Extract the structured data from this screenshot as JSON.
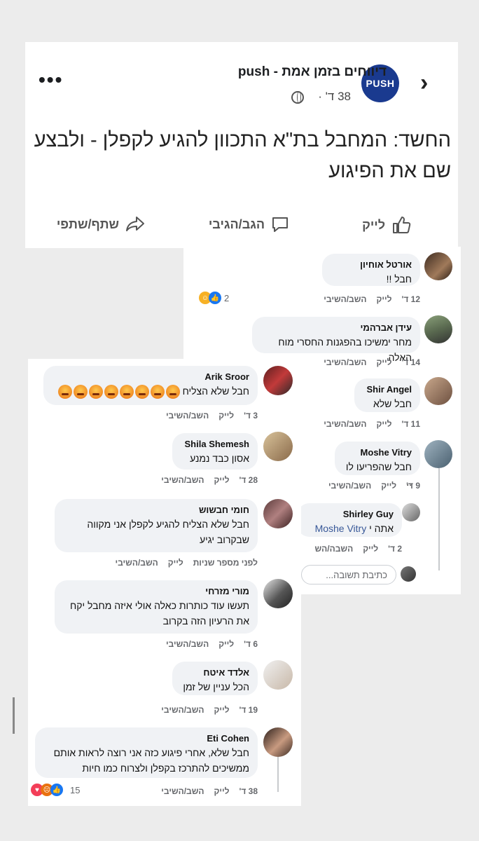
{
  "post": {
    "page_name": "דיווחים בזמן אמת - push",
    "logo_text": "PUSH",
    "time": "38 ד' ·",
    "headline": "החשד: המחבל בת\"א התכוון להגיע לקפלן - ולבצע שם את הפיגוע",
    "actions": {
      "like": "לייק",
      "comment": "הגב/הגיבי",
      "share": "שתף/שתפי"
    }
  },
  "labels": {
    "like": "לייק",
    "reply": "השב/השיבי",
    "reply_placeholder": "כתיבת תשובה..."
  },
  "comments_right": [
    {
      "name": "אורטל אוחיון",
      "text": "חבל !!",
      "time": "12 ד'",
      "reactions": "2"
    },
    {
      "name": "עידן אברהמי",
      "text": "מחר ימשיכו בהפגנות החסרי מוח האלה",
      "time": "14 ד'"
    },
    {
      "name": "Shir Angel",
      "text": "חבל שלא",
      "time": "11 ד'"
    },
    {
      "name": "Moshe Vitry",
      "text": "חבל שהפריעו לו ..",
      "time": "9 ד'"
    },
    {
      "name": "Shirley Guy",
      "mention": "Moshe Vitry",
      "text": "אתה י",
      "time": "2 ד'",
      "like_cut": "לייק",
      "reply_cut": "השבה/הש"
    }
  ],
  "comments_left": [
    {
      "name": "Arik Sroor",
      "text": "חבל שלא הצליח",
      "time": "3 ד'"
    },
    {
      "name": "Shila Shemesh",
      "text": "אסון כבד נמנע",
      "time": "28 ד'"
    },
    {
      "name": "חומי חבשוש",
      "text": "חבל שלא הצליח  להגיע לקפלן אני מקווה  שבקרוב יגיע",
      "time": "לפני מספר שניות"
    },
    {
      "name": "מורי מזרחי",
      "text": "תעשו עוד כותרות כאלה אולי איזה מחבל יקח את הרעיון הזה בקרוב",
      "time": "6 ד'"
    },
    {
      "name": "אלדד איטח",
      "text": "הכל עניין של זמן",
      "time": "19 ד'"
    },
    {
      "name": "Eti Cohen",
      "text": "חבל שלא, אחרי פיגוע כזה אני רוצה לראות אותם ממשיכים להתרכז בקפלן ולצרוח כמו חיות",
      "time": "38 ד'",
      "reactions": "15"
    }
  ],
  "colors": {
    "brand": "#1a3a8f",
    "link": "#385898",
    "bubble": "#f0f2f5",
    "meta": "#65676b"
  },
  "icons": [
    "back-chevron-icon",
    "more-dots-icon",
    "globe-icon",
    "like-thumb-icon",
    "comment-icon",
    "share-arrow-icon",
    "angry-emoji-icon",
    "like-reaction-icon",
    "haha-reaction-icon",
    "love-reaction-icon"
  ]
}
